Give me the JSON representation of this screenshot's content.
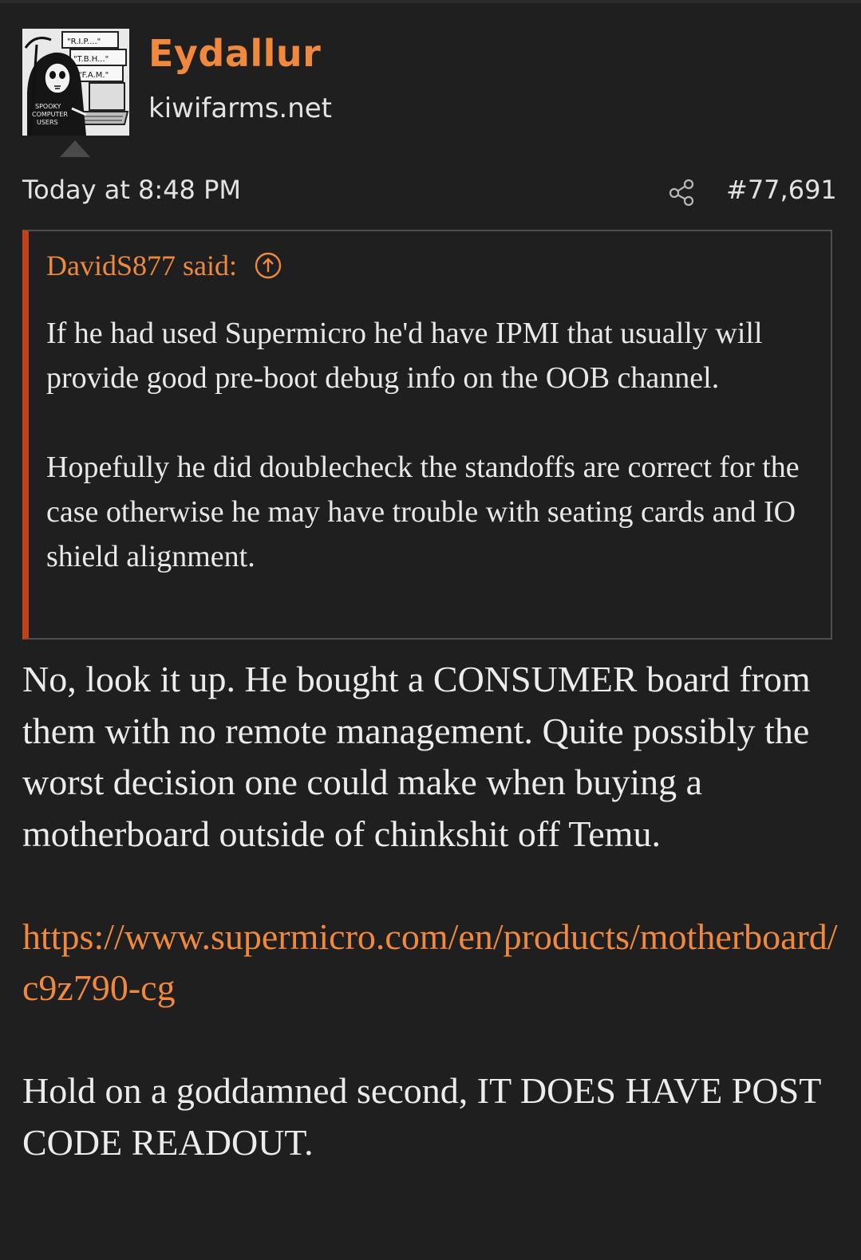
{
  "post": {
    "author": {
      "name": "Eydallur",
      "title": "kiwifarms.net",
      "avatar": {
        "signs": [
          "\"R.I.P....\"",
          "\"T.B.H...\"",
          "\"F.A.M.\""
        ],
        "shirt_text": [
          "SPOOKY",
          "COMPUTER",
          "USERS"
        ],
        "icon": "grim-reaper-avatar"
      }
    },
    "date": "Today at 8:48 PM",
    "number": "#77,691",
    "share_icon": "share-icon",
    "quote": {
      "author_label": "DavidS877 said:",
      "jump_icon": "arrow-up-circle-icon",
      "paragraphs": [
        "If he had used Supermicro he'd have IPMI that usually will provide good pre-boot debug info on the OOB channel.",
        "Hopefully he did doublecheck the standoffs are correct for the case otherwise he may have trouble with seating cards and IO shield alignment."
      ]
    },
    "message": {
      "paragraph1": "No, look it up. He bought a CONSUMER board from them with no remote management. Quite possibly the worst decision one could make when buying a motherboard outside of chinkshit off Temu.",
      "link": "https://www.supermicro.com/en/products/motherboard/c9z790-cg",
      "paragraph3": "Hold on a goddamned second, IT DOES HAVE POST CODE READOUT."
    }
  },
  "colors": {
    "background": "#1f1f1f",
    "accent": "#f0883e",
    "quote_bar": "#c2401a",
    "text": "#e6e6e6"
  }
}
